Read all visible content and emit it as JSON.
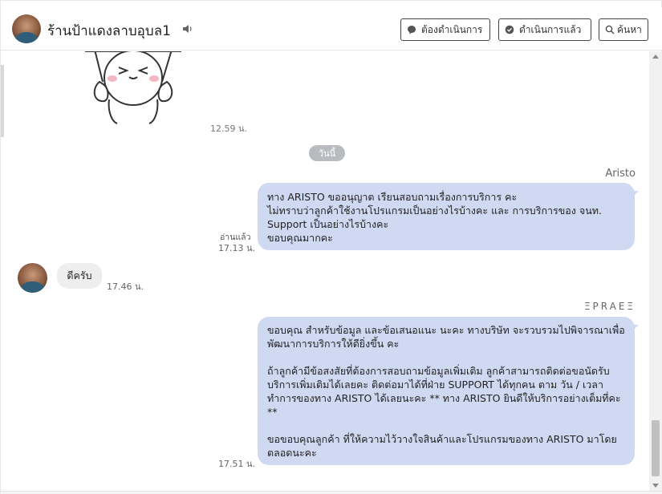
{
  "header": {
    "title": "ร้านป้าแดงลาบอุบล1",
    "buttons": {
      "pending": "ต้องดำเนินการ",
      "done": "ดำเนินการแล้ว",
      "search": "ค้นหา"
    }
  },
  "messages": {
    "sticker_time": "12.59 น.",
    "date_divider": "วันนี้",
    "sender_1": "Aristo",
    "bubble_1": "ทาง ARISTO ขออนุญาต เรียนสอบถามเรื่องการบริการ คะ\nไม่ทราบว่าลูกค้าใช้งานโปรแกรมเป็นอย่างไรบ้างคะ และ  การบริการของ จนท. Support เป็นอย่างไรบ้างคะ\nขอบคุณมากคะ",
    "read_label": "อ่านแล้ว",
    "time_1": "17.13 น.",
    "incoming_text": "ดีครับ",
    "incoming_time": "17.46 น.",
    "sender_2": "ΞPRAEΞ",
    "bubble_2": "ขอบคุณ สำหรับข้อมูล และข้อเสนอแนะ นะคะ ทางบริษัท จะรวบรวมไปพิจารณาเพื่อพัฒนาการบริการให้ดียิ่งขึ้น คะ\n\nถ้าลูกค้ามีข้อสงสัยที่ต้องการสอบถามข้อมูลเพิ่มเติม ลูกค้าสามารถติดต่อขอนัดรับบริการเพิ่มเติมได้เลยคะ ติดต่อมาได้ที่ฝ่าย SUPPORT ได้ทุกคน ตาม วัน / เวลา ทำการของทาง ARISTO ได้เลยนะคะ ** ทาง ARISTO ยินดีให้บริการอย่างเต็มที่คะ **\n\nขอขอบคุณลูกค้า ที่ให้ความไว้วางใจสินค้าและโปรแกรมของทาง ARISTO มาโดยตลอดนะคะ",
    "time_2": "17.51 น."
  },
  "icons": {
    "mute": "speaker-icon",
    "pending": "chat-bubble-icon",
    "done": "chat-check-icon",
    "search": "search-icon"
  },
  "colors": {
    "outgoing_bubble": "#cfdaf2",
    "incoming_bubble": "#eeeeee",
    "date_pill": "#b8bcc0"
  }
}
